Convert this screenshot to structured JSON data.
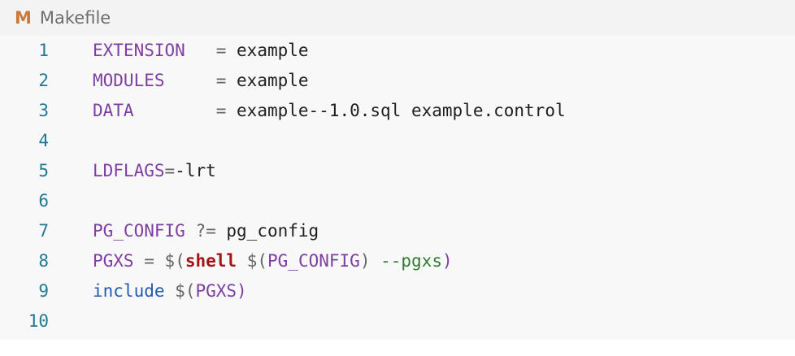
{
  "tab": {
    "icon_glyph": "M",
    "label": "Makefile",
    "icon_color": "#c87a3c"
  },
  "editor": {
    "lines": [
      {
        "number": "1",
        "tokens": [
          {
            "text": "EXTENSION",
            "kind": "var"
          },
          {
            "text": "   ",
            "kind": "text"
          },
          {
            "text": "=",
            "kind": "op"
          },
          {
            "text": " example",
            "kind": "text"
          }
        ]
      },
      {
        "number": "2",
        "tokens": [
          {
            "text": "MODULES",
            "kind": "var"
          },
          {
            "text": "     ",
            "kind": "text"
          },
          {
            "text": "=",
            "kind": "op"
          },
          {
            "text": " example",
            "kind": "text"
          }
        ]
      },
      {
        "number": "3",
        "tokens": [
          {
            "text": "DATA",
            "kind": "var"
          },
          {
            "text": "        ",
            "kind": "text"
          },
          {
            "text": "=",
            "kind": "op"
          },
          {
            "text": " example--1.0.sql example.control",
            "kind": "text"
          }
        ]
      },
      {
        "number": "4",
        "tokens": []
      },
      {
        "number": "5",
        "tokens": [
          {
            "text": "LDFLAGS",
            "kind": "var"
          },
          {
            "text": "=",
            "kind": "op"
          },
          {
            "text": "-lrt",
            "kind": "text"
          }
        ]
      },
      {
        "number": "6",
        "tokens": []
      },
      {
        "number": "7",
        "tokens": [
          {
            "text": "PG_CONFIG",
            "kind": "var"
          },
          {
            "text": " ",
            "kind": "text"
          },
          {
            "text": "?=",
            "kind": "op"
          },
          {
            "text": " pg_config",
            "kind": "text"
          }
        ]
      },
      {
        "number": "8",
        "tokens": [
          {
            "text": "PGXS",
            "kind": "var"
          },
          {
            "text": " ",
            "kind": "text"
          },
          {
            "text": "=",
            "kind": "op"
          },
          {
            "text": " ",
            "kind": "text"
          },
          {
            "text": "$(",
            "kind": "op"
          },
          {
            "text": "shell",
            "kind": "fn"
          },
          {
            "text": " ",
            "kind": "text"
          },
          {
            "text": "$(",
            "kind": "op"
          },
          {
            "text": "PG_CONFIG",
            "kind": "var"
          },
          {
            "text": ")",
            "kind": "op"
          },
          {
            "text": " --pgxs",
            "kind": "str"
          },
          {
            "text": ")",
            "kind": "var"
          }
        ]
      },
      {
        "number": "9",
        "tokens": [
          {
            "text": "include",
            "kind": "kw"
          },
          {
            "text": " ",
            "kind": "text"
          },
          {
            "text": "$(",
            "kind": "op"
          },
          {
            "text": "PGXS",
            "kind": "var"
          },
          {
            "text": ")",
            "kind": "var"
          }
        ]
      },
      {
        "number": "10",
        "tokens": []
      }
    ]
  }
}
